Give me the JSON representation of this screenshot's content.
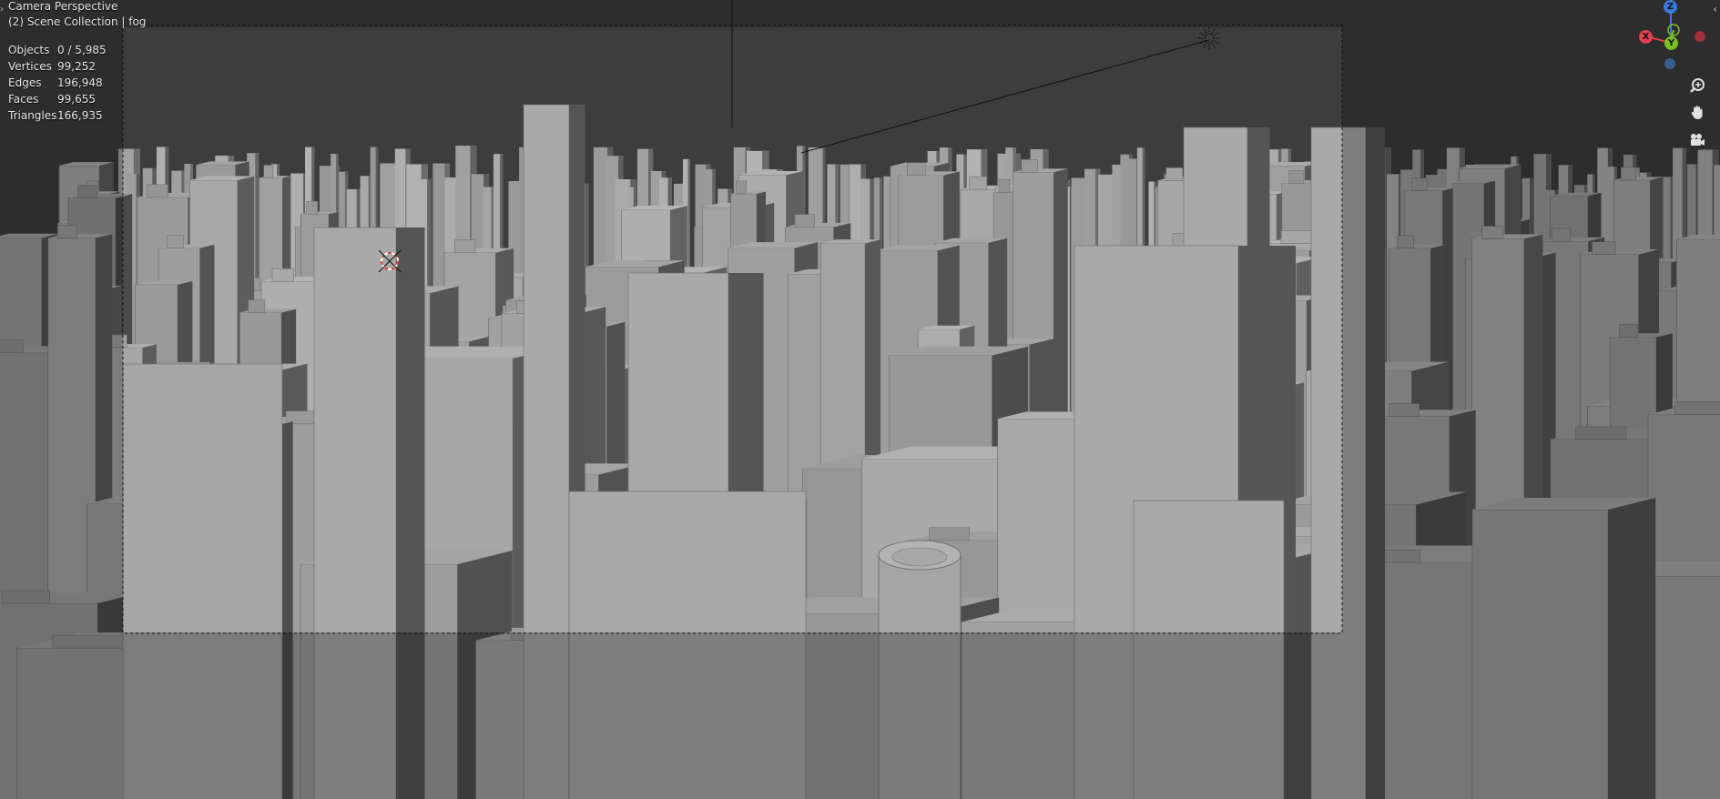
{
  "viewport": {
    "mode": "Camera Perspective",
    "collection": "(2) Scene Collection | fog"
  },
  "stats": [
    {
      "label": "Objects",
      "value": "0 / 5,985"
    },
    {
      "label": "Vertices",
      "value": "99,252"
    },
    {
      "label": "Edges",
      "value": "196,948"
    },
    {
      "label": "Faces",
      "value": "99,655"
    },
    {
      "label": "Triangles",
      "value": "166,935"
    }
  ],
  "gizmo": {
    "axis_z": "Z",
    "axis_y": "Y",
    "axis_x": "X",
    "color_x": "#e04050",
    "color_y": "#7cc020",
    "color_z": "#3a7ae0"
  },
  "nav_icons": [
    "zoom-icon",
    "pan-hand-icon",
    "camera-view-icon"
  ],
  "colors": {
    "background": "#3d3d3d",
    "building_light": "#a8a8a8",
    "building_dark": "#555555"
  }
}
